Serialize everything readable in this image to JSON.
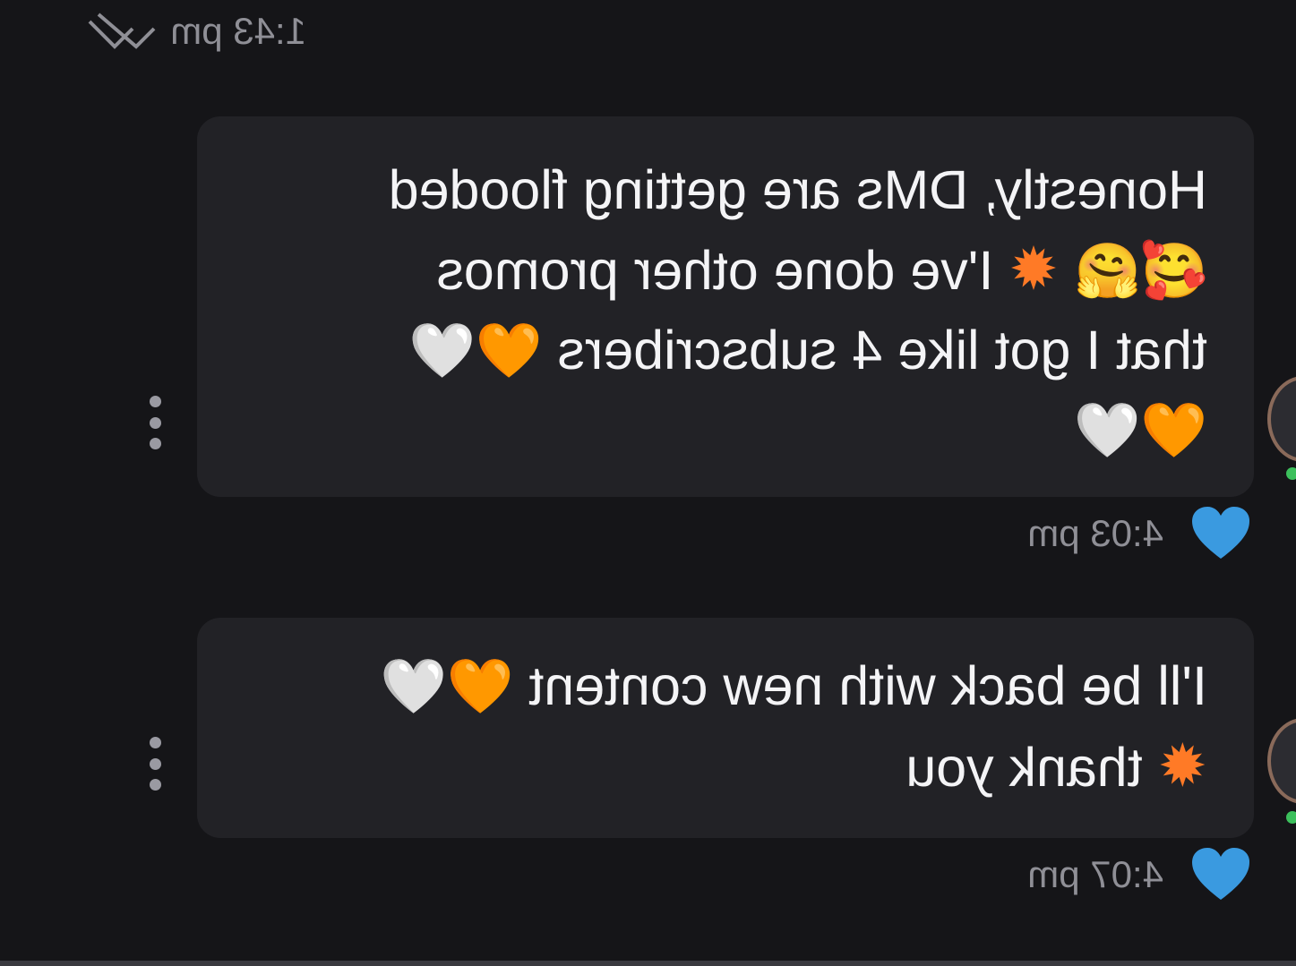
{
  "top": {
    "time": "1:43 pm",
    "status_icon": "double-check-icon"
  },
  "messages": [
    {
      "lines": [
        {
          "text": "Honestly, DMs are getting flooded"
        },
        {
          "prefix_emoji": "🥰🤗",
          "spark": "✹",
          "text": " I've done other promos"
        },
        {
          "text": "that I got like 4 subscribers ",
          "hearts": "🧡🤍"
        },
        {
          "hearts": "🧡🤍"
        }
      ],
      "reaction": "💙",
      "time": "4:03 pm"
    },
    {
      "lines": [
        {
          "text": "I'll be back with new content ",
          "hearts": "🧡🤍"
        },
        {
          "spark": "✹",
          "text": " thank you"
        }
      ],
      "reaction": "💙",
      "time": "4:07 pm"
    }
  ],
  "colors": {
    "background": "#151518",
    "bubble": "#222226",
    "text": "#f4f4f6",
    "muted": "#8f8f96",
    "reaction_heart": "#3a9ae0",
    "online": "#3cc05c"
  }
}
